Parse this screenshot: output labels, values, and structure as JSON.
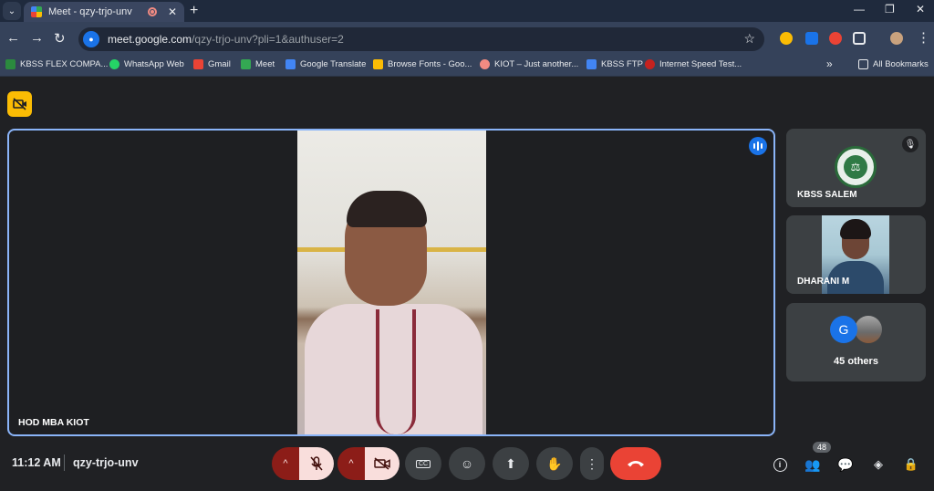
{
  "browser": {
    "tab_title": "Meet - qzy-trjo-unv",
    "new_tab_symbol": "+",
    "close_symbol": "✕",
    "window_controls": [
      "—",
      "❐",
      "✕"
    ],
    "url_host": "meet.google.com",
    "url_path": "/qzy-trjo-unv?pli=1&authuser=2",
    "bookmarks": [
      {
        "label": "KBSS FLEX COMPA...",
        "color": "#2b8a3e"
      },
      {
        "label": "WhatsApp Web",
        "color": "#25d366"
      },
      {
        "label": "Gmail",
        "color": "#ea4335"
      },
      {
        "label": "Meet",
        "color": "#34a853"
      },
      {
        "label": "Google Translate",
        "color": "#4285f4"
      },
      {
        "label": "Browse Fonts - Goo...",
        "color": "#fbbc04"
      },
      {
        "label": "KIOT – Just another...",
        "color": "#f28b82"
      },
      {
        "label": "KBSS FTP",
        "color": "#4285f4"
      },
      {
        "label": "Internet Speed Test...",
        "color": "#c5221f"
      }
    ],
    "more_bookmarks": "»",
    "all_bookmarks": "All Bookmarks"
  },
  "meet": {
    "speaker_name": "HOD MBA KIOT",
    "participants": [
      {
        "name": "KBSS SALEM"
      },
      {
        "name": "DHARANI M"
      }
    ],
    "others_avatar_letter": "G",
    "others_label": "45 others",
    "time": "11:12 AM",
    "meeting_code": "qzy-trjo-unv",
    "participant_count": "48"
  },
  "colors": {
    "accent": "#8ab4f8",
    "end_call": "#ea4335",
    "muted_bg": "#f9dedc",
    "muted_dark": "#8c1d18"
  }
}
